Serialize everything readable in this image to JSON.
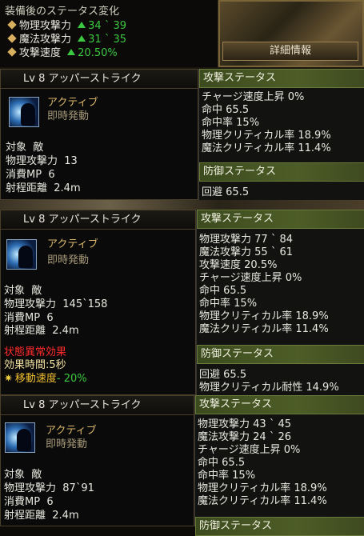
{
  "top": {
    "title": "装備後のステータス変化",
    "rows": [
      {
        "label": "物理攻撃力",
        "value": "34 ` 39"
      },
      {
        "label": "魔法攻撃力",
        "value": "31 ` 35"
      },
      {
        "label": "攻撃速度",
        "value": "20.50%"
      }
    ],
    "detail_button": "詳細情報"
  },
  "cards": [
    {
      "skill_name": "Lv 8 アッパーストライク",
      "type": "アクティブ",
      "activation": "即時発動",
      "target_label": "対象",
      "target_value": "敵",
      "atk_label": "物理攻撃力",
      "atk_value": "13",
      "mp_label": "消費MP",
      "mp_value": "6",
      "range_label": "射程距離",
      "range_value": "2.4m",
      "attack_header": "攻撃ステータス",
      "attack_stats": [
        {
          "label": "チャージ速度上昇",
          "value": "0%"
        },
        {
          "label": "命中",
          "value": "65.5"
        },
        {
          "label": "命中率",
          "value": "15%"
        },
        {
          "label": "物理クリティカル率",
          "value": "18.9%"
        },
        {
          "label": "魔法クリティカル率",
          "value": "11.4%"
        }
      ],
      "defense_header": "防御ステータス",
      "defense_stats": [
        {
          "label": "回避",
          "value": "65.5"
        }
      ]
    },
    {
      "skill_name": "Lv 8 アッパーストライク",
      "type": "アクティブ",
      "activation": "即時発動",
      "target_label": "対象",
      "target_value": "敵",
      "atk_label": "物理攻撃力",
      "atk_value": "145`158",
      "mp_label": "消費MP",
      "mp_value": "6",
      "range_label": "射程距離",
      "range_value": "2.4m",
      "status_effect": {
        "title": "状態異常効果",
        "duration_label": "効果時間",
        "duration_value": ":5秒",
        "effect_label": "移動速度",
        "effect_value": "- 20%"
      },
      "attack_header": "攻撃ステータス",
      "attack_stats": [
        {
          "label": "物理攻撃力",
          "value": "77 ` 84"
        },
        {
          "label": "魔法攻撃力",
          "value": "55 ` 61"
        },
        {
          "label": "攻撃速度",
          "value": "20.5%"
        },
        {
          "label": "チャージ速度上昇",
          "value": "0%"
        },
        {
          "label": "命中",
          "value": "65.5"
        },
        {
          "label": "命中率",
          "value": "15%"
        },
        {
          "label": "物理クリティカル率",
          "value": "18.9%"
        },
        {
          "label": "魔法クリティカル率",
          "value": "11.4%"
        }
      ],
      "defense_header": "防御ステータス",
      "defense_stats": [
        {
          "label": "回避",
          "value": "65.5"
        },
        {
          "label": "物理クリティカル耐性",
          "value": "14.9%"
        }
      ]
    },
    {
      "skill_name": "Lv 8 アッパーストライク",
      "type": "アクティブ",
      "activation": "即時発動",
      "target_label": "対象",
      "target_value": "敵",
      "atk_label": "物理攻撃力",
      "atk_value": "87`91",
      "mp_label": "消費MP",
      "mp_value": "6",
      "range_label": "射程距離",
      "range_value": "2.4m",
      "attack_header": "攻撃ステータス",
      "attack_stats": [
        {
          "label": "物理攻撃力",
          "value": "43 ` 45"
        },
        {
          "label": "魔法攻撃力",
          "value": "24 ` 26"
        },
        {
          "label": "チャージ速度上昇",
          "value": "0%"
        },
        {
          "label": "命中",
          "value": "65.5"
        },
        {
          "label": "命中率",
          "value": "15%"
        },
        {
          "label": "物理クリティカル率",
          "value": "18.9%"
        },
        {
          "label": "魔法クリティカル率",
          "value": "11.4%"
        }
      ],
      "defense_header": "防御ステータス"
    }
  ],
  "colors": {
    "accent_green": "#3cc840",
    "status_red": "#ff2a2a",
    "header_olive": "#4d5d27"
  }
}
